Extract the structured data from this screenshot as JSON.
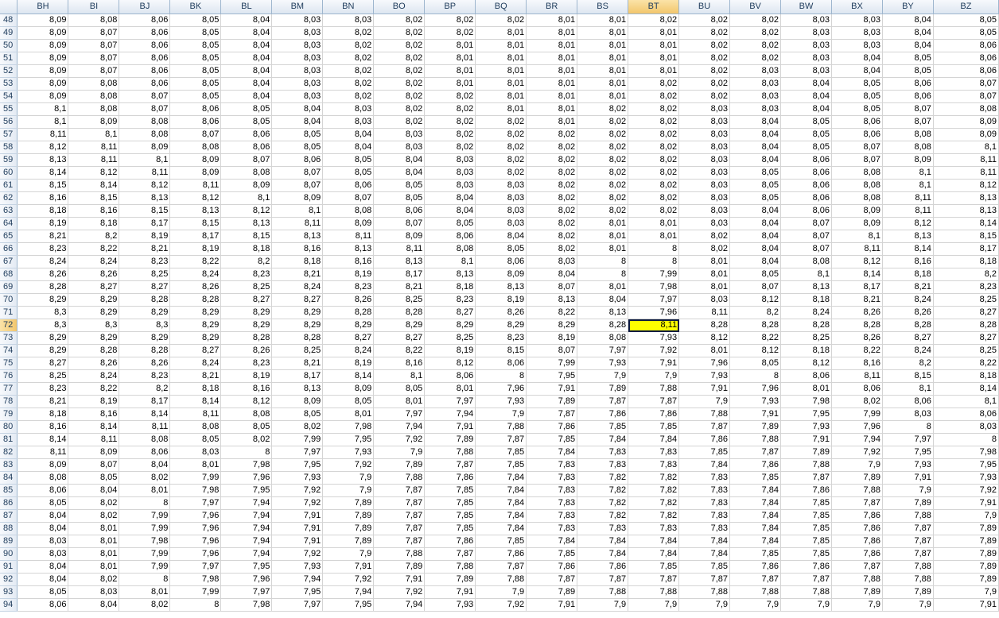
{
  "sheet": {
    "columns": [
      "BH",
      "BI",
      "BJ",
      "BK",
      "BL",
      "BM",
      "BN",
      "BO",
      "BP",
      "BQ",
      "BR",
      "BS",
      "BT",
      "BU",
      "BV",
      "BW",
      "BX",
      "BY",
      "BZ"
    ],
    "active_column": "BT",
    "active_row": "72",
    "selection_color": "#ffff00",
    "rows": [
      {
        "num": "48",
        "cells": [
          "8,09",
          "8,08",
          "8,06",
          "8,05",
          "8,04",
          "8,03",
          "8,03",
          "8,02",
          "8,02",
          "8,02",
          "8,01",
          "8,01",
          "8,02",
          "8,02",
          "8,02",
          "8,03",
          "8,03",
          "8,04",
          "8,05"
        ]
      },
      {
        "num": "49",
        "cells": [
          "8,09",
          "8,07",
          "8,06",
          "8,05",
          "8,04",
          "8,03",
          "8,02",
          "8,02",
          "8,02",
          "8,01",
          "8,01",
          "8,01",
          "8,01",
          "8,02",
          "8,02",
          "8,03",
          "8,03",
          "8,04",
          "8,05"
        ]
      },
      {
        "num": "50",
        "cells": [
          "8,09",
          "8,07",
          "8,06",
          "8,05",
          "8,04",
          "8,03",
          "8,02",
          "8,02",
          "8,01",
          "8,01",
          "8,01",
          "8,01",
          "8,01",
          "8,02",
          "8,02",
          "8,03",
          "8,03",
          "8,04",
          "8,06"
        ]
      },
      {
        "num": "51",
        "cells": [
          "8,09",
          "8,07",
          "8,06",
          "8,05",
          "8,04",
          "8,03",
          "8,02",
          "8,02",
          "8,01",
          "8,01",
          "8,01",
          "8,01",
          "8,01",
          "8,02",
          "8,02",
          "8,03",
          "8,04",
          "8,05",
          "8,06"
        ]
      },
      {
        "num": "52",
        "cells": [
          "8,09",
          "8,07",
          "8,06",
          "8,05",
          "8,04",
          "8,03",
          "8,02",
          "8,02",
          "8,01",
          "8,01",
          "8,01",
          "8,01",
          "8,01",
          "8,02",
          "8,03",
          "8,03",
          "8,04",
          "8,05",
          "8,06"
        ]
      },
      {
        "num": "53",
        "cells": [
          "8,09",
          "8,08",
          "8,06",
          "8,05",
          "8,04",
          "8,03",
          "8,02",
          "8,02",
          "8,01",
          "8,01",
          "8,01",
          "8,01",
          "8,02",
          "8,02",
          "8,03",
          "8,04",
          "8,05",
          "8,06",
          "8,07"
        ]
      },
      {
        "num": "54",
        "cells": [
          "8,09",
          "8,08",
          "8,07",
          "8,05",
          "8,04",
          "8,03",
          "8,02",
          "8,02",
          "8,02",
          "8,01",
          "8,01",
          "8,01",
          "8,02",
          "8,02",
          "8,03",
          "8,04",
          "8,05",
          "8,06",
          "8,07"
        ]
      },
      {
        "num": "55",
        "cells": [
          "8,1",
          "8,08",
          "8,07",
          "8,06",
          "8,05",
          "8,04",
          "8,03",
          "8,02",
          "8,02",
          "8,01",
          "8,01",
          "8,02",
          "8,02",
          "8,03",
          "8,03",
          "8,04",
          "8,05",
          "8,07",
          "8,08"
        ]
      },
      {
        "num": "56",
        "cells": [
          "8,1",
          "8,09",
          "8,08",
          "8,06",
          "8,05",
          "8,04",
          "8,03",
          "8,02",
          "8,02",
          "8,02",
          "8,01",
          "8,02",
          "8,02",
          "8,03",
          "8,04",
          "8,05",
          "8,06",
          "8,07",
          "8,09"
        ]
      },
      {
        "num": "57",
        "cells": [
          "8,11",
          "8,1",
          "8,08",
          "8,07",
          "8,06",
          "8,05",
          "8,04",
          "8,03",
          "8,02",
          "8,02",
          "8,02",
          "8,02",
          "8,02",
          "8,03",
          "8,04",
          "8,05",
          "8,06",
          "8,08",
          "8,09"
        ]
      },
      {
        "num": "58",
        "cells": [
          "8,12",
          "8,11",
          "8,09",
          "8,08",
          "8,06",
          "8,05",
          "8,04",
          "8,03",
          "8,02",
          "8,02",
          "8,02",
          "8,02",
          "8,02",
          "8,03",
          "8,04",
          "8,05",
          "8,07",
          "8,08",
          "8,1"
        ]
      },
      {
        "num": "59",
        "cells": [
          "8,13",
          "8,11",
          "8,1",
          "8,09",
          "8,07",
          "8,06",
          "8,05",
          "8,04",
          "8,03",
          "8,02",
          "8,02",
          "8,02",
          "8,02",
          "8,03",
          "8,04",
          "8,06",
          "8,07",
          "8,09",
          "8,11"
        ]
      },
      {
        "num": "60",
        "cells": [
          "8,14",
          "8,12",
          "8,11",
          "8,09",
          "8,08",
          "8,07",
          "8,05",
          "8,04",
          "8,03",
          "8,02",
          "8,02",
          "8,02",
          "8,02",
          "8,03",
          "8,05",
          "8,06",
          "8,08",
          "8,1",
          "8,11"
        ]
      },
      {
        "num": "61",
        "cells": [
          "8,15",
          "8,14",
          "8,12",
          "8,11",
          "8,09",
          "8,07",
          "8,06",
          "8,05",
          "8,03",
          "8,03",
          "8,02",
          "8,02",
          "8,02",
          "8,03",
          "8,05",
          "8,06",
          "8,08",
          "8,1",
          "8,12"
        ]
      },
      {
        "num": "62",
        "cells": [
          "8,16",
          "8,15",
          "8,13",
          "8,12",
          "8,1",
          "8,09",
          "8,07",
          "8,05",
          "8,04",
          "8,03",
          "8,02",
          "8,02",
          "8,02",
          "8,03",
          "8,05",
          "8,06",
          "8,08",
          "8,11",
          "8,13"
        ]
      },
      {
        "num": "63",
        "cells": [
          "8,18",
          "8,16",
          "8,15",
          "8,13",
          "8,12",
          "8,1",
          "8,08",
          "8,06",
          "8,04",
          "8,03",
          "8,02",
          "8,02",
          "8,02",
          "8,03",
          "8,04",
          "8,06",
          "8,09",
          "8,11",
          "8,13"
        ]
      },
      {
        "num": "64",
        "cells": [
          "8,19",
          "8,18",
          "8,17",
          "8,15",
          "8,13",
          "8,11",
          "8,09",
          "8,07",
          "8,05",
          "8,03",
          "8,02",
          "8,01",
          "8,01",
          "8,03",
          "8,04",
          "8,07",
          "8,09",
          "8,12",
          "8,14"
        ]
      },
      {
        "num": "65",
        "cells": [
          "8,21",
          "8,2",
          "8,19",
          "8,17",
          "8,15",
          "8,13",
          "8,11",
          "8,09",
          "8,06",
          "8,04",
          "8,02",
          "8,01",
          "8,01",
          "8,02",
          "8,04",
          "8,07",
          "8,1",
          "8,13",
          "8,15"
        ]
      },
      {
        "num": "66",
        "cells": [
          "8,23",
          "8,22",
          "8,21",
          "8,19",
          "8,18",
          "8,16",
          "8,13",
          "8,11",
          "8,08",
          "8,05",
          "8,02",
          "8,01",
          "8",
          "8,02",
          "8,04",
          "8,07",
          "8,11",
          "8,14",
          "8,17"
        ]
      },
      {
        "num": "67",
        "cells": [
          "8,24",
          "8,24",
          "8,23",
          "8,22",
          "8,2",
          "8,18",
          "8,16",
          "8,13",
          "8,1",
          "8,06",
          "8,03",
          "8",
          "8",
          "8,01",
          "8,04",
          "8,08",
          "8,12",
          "8,16",
          "8,18"
        ]
      },
      {
        "num": "68",
        "cells": [
          "8,26",
          "8,26",
          "8,25",
          "8,24",
          "8,23",
          "8,21",
          "8,19",
          "8,17",
          "8,13",
          "8,09",
          "8,04",
          "8",
          "7,99",
          "8,01",
          "8,05",
          "8,1",
          "8,14",
          "8,18",
          "8,2"
        ]
      },
      {
        "num": "69",
        "cells": [
          "8,28",
          "8,27",
          "8,27",
          "8,26",
          "8,25",
          "8,24",
          "8,23",
          "8,21",
          "8,18",
          "8,13",
          "8,07",
          "8,01",
          "7,98",
          "8,01",
          "8,07",
          "8,13",
          "8,17",
          "8,21",
          "8,23"
        ]
      },
      {
        "num": "70",
        "cells": [
          "8,29",
          "8,29",
          "8,28",
          "8,28",
          "8,27",
          "8,27",
          "8,26",
          "8,25",
          "8,23",
          "8,19",
          "8,13",
          "8,04",
          "7,97",
          "8,03",
          "8,12",
          "8,18",
          "8,21",
          "8,24",
          "8,25"
        ]
      },
      {
        "num": "71",
        "cells": [
          "8,3",
          "8,29",
          "8,29",
          "8,29",
          "8,29",
          "8,29",
          "8,28",
          "8,28",
          "8,27",
          "8,26",
          "8,22",
          "8,13",
          "7,96",
          "8,11",
          "8,2",
          "8,24",
          "8,26",
          "8,26",
          "8,27"
        ]
      },
      {
        "num": "72",
        "cells": [
          "8,3",
          "8,3",
          "8,3",
          "8,29",
          "8,29",
          "8,29",
          "8,29",
          "8,29",
          "8,29",
          "8,29",
          "8,29",
          "8,28",
          "8,11",
          "8,28",
          "8,28",
          "8,28",
          "8,28",
          "8,28",
          "8,28"
        ]
      },
      {
        "num": "73",
        "cells": [
          "8,29",
          "8,29",
          "8,29",
          "8,29",
          "8,28",
          "8,28",
          "8,27",
          "8,27",
          "8,25",
          "8,23",
          "8,19",
          "8,08",
          "7,93",
          "8,12",
          "8,22",
          "8,25",
          "8,26",
          "8,27",
          "8,27"
        ]
      },
      {
        "num": "74",
        "cells": [
          "8,29",
          "8,28",
          "8,28",
          "8,27",
          "8,26",
          "8,25",
          "8,24",
          "8,22",
          "8,19",
          "8,15",
          "8,07",
          "7,97",
          "7,92",
          "8,01",
          "8,12",
          "8,18",
          "8,22",
          "8,24",
          "8,25"
        ]
      },
      {
        "num": "75",
        "cells": [
          "8,27",
          "8,26",
          "8,26",
          "8,24",
          "8,23",
          "8,21",
          "8,19",
          "8,16",
          "8,12",
          "8,06",
          "7,99",
          "7,93",
          "7,91",
          "7,96",
          "8,05",
          "8,12",
          "8,16",
          "8,2",
          "8,22"
        ]
      },
      {
        "num": "76",
        "cells": [
          "8,25",
          "8,24",
          "8,23",
          "8,21",
          "8,19",
          "8,17",
          "8,14",
          "8,1",
          "8,06",
          "8",
          "7,95",
          "7,9",
          "7,9",
          "7,93",
          "8",
          "8,06",
          "8,11",
          "8,15",
          "8,18"
        ]
      },
      {
        "num": "77",
        "cells": [
          "8,23",
          "8,22",
          "8,2",
          "8,18",
          "8,16",
          "8,13",
          "8,09",
          "8,05",
          "8,01",
          "7,96",
          "7,91",
          "7,89",
          "7,88",
          "7,91",
          "7,96",
          "8,01",
          "8,06",
          "8,1",
          "8,14"
        ]
      },
      {
        "num": "78",
        "cells": [
          "8,21",
          "8,19",
          "8,17",
          "8,14",
          "8,12",
          "8,09",
          "8,05",
          "8,01",
          "7,97",
          "7,93",
          "7,89",
          "7,87",
          "7,87",
          "7,9",
          "7,93",
          "7,98",
          "8,02",
          "8,06",
          "8,1"
        ]
      },
      {
        "num": "79",
        "cells": [
          "8,18",
          "8,16",
          "8,14",
          "8,11",
          "8,08",
          "8,05",
          "8,01",
          "7,97",
          "7,94",
          "7,9",
          "7,87",
          "7,86",
          "7,86",
          "7,88",
          "7,91",
          "7,95",
          "7,99",
          "8,03",
          "8,06"
        ]
      },
      {
        "num": "80",
        "cells": [
          "8,16",
          "8,14",
          "8,11",
          "8,08",
          "8,05",
          "8,02",
          "7,98",
          "7,94",
          "7,91",
          "7,88",
          "7,86",
          "7,85",
          "7,85",
          "7,87",
          "7,89",
          "7,93",
          "7,96",
          "8",
          "8,03"
        ]
      },
      {
        "num": "81",
        "cells": [
          "8,14",
          "8,11",
          "8,08",
          "8,05",
          "8,02",
          "7,99",
          "7,95",
          "7,92",
          "7,89",
          "7,87",
          "7,85",
          "7,84",
          "7,84",
          "7,86",
          "7,88",
          "7,91",
          "7,94",
          "7,97",
          "8"
        ]
      },
      {
        "num": "82",
        "cells": [
          "8,11",
          "8,09",
          "8,06",
          "8,03",
          "8",
          "7,97",
          "7,93",
          "7,9",
          "7,88",
          "7,85",
          "7,84",
          "7,83",
          "7,83",
          "7,85",
          "7,87",
          "7,89",
          "7,92",
          "7,95",
          "7,98"
        ]
      },
      {
        "num": "83",
        "cells": [
          "8,09",
          "8,07",
          "8,04",
          "8,01",
          "7,98",
          "7,95",
          "7,92",
          "7,89",
          "7,87",
          "7,85",
          "7,83",
          "7,83",
          "7,83",
          "7,84",
          "7,86",
          "7,88",
          "7,9",
          "7,93",
          "7,95"
        ]
      },
      {
        "num": "84",
        "cells": [
          "8,08",
          "8,05",
          "8,02",
          "7,99",
          "7,96",
          "7,93",
          "7,9",
          "7,88",
          "7,86",
          "7,84",
          "7,83",
          "7,82",
          "7,82",
          "7,83",
          "7,85",
          "7,87",
          "7,89",
          "7,91",
          "7,93"
        ]
      },
      {
        "num": "85",
        "cells": [
          "8,06",
          "8,04",
          "8,01",
          "7,98",
          "7,95",
          "7,92",
          "7,9",
          "7,87",
          "7,85",
          "7,84",
          "7,83",
          "7,82",
          "7,82",
          "7,83",
          "7,84",
          "7,86",
          "7,88",
          "7,9",
          "7,92"
        ]
      },
      {
        "num": "86",
        "cells": [
          "8,05",
          "8,02",
          "8",
          "7,97",
          "7,94",
          "7,92",
          "7,89",
          "7,87",
          "7,85",
          "7,84",
          "7,83",
          "7,82",
          "7,82",
          "7,83",
          "7,84",
          "7,85",
          "7,87",
          "7,89",
          "7,91"
        ]
      },
      {
        "num": "87",
        "cells": [
          "8,04",
          "8,02",
          "7,99",
          "7,96",
          "7,94",
          "7,91",
          "7,89",
          "7,87",
          "7,85",
          "7,84",
          "7,83",
          "7,82",
          "7,82",
          "7,83",
          "7,84",
          "7,85",
          "7,86",
          "7,88",
          "7,9"
        ]
      },
      {
        "num": "88",
        "cells": [
          "8,04",
          "8,01",
          "7,99",
          "7,96",
          "7,94",
          "7,91",
          "7,89",
          "7,87",
          "7,85",
          "7,84",
          "7,83",
          "7,83",
          "7,83",
          "7,83",
          "7,84",
          "7,85",
          "7,86",
          "7,87",
          "7,89"
        ]
      },
      {
        "num": "89",
        "cells": [
          "8,03",
          "8,01",
          "7,98",
          "7,96",
          "7,94",
          "7,91",
          "7,89",
          "7,87",
          "7,86",
          "7,85",
          "7,84",
          "7,84",
          "7,84",
          "7,84",
          "7,84",
          "7,85",
          "7,86",
          "7,87",
          "7,89"
        ]
      },
      {
        "num": "90",
        "cells": [
          "8,03",
          "8,01",
          "7,99",
          "7,96",
          "7,94",
          "7,92",
          "7,9",
          "7,88",
          "7,87",
          "7,86",
          "7,85",
          "7,84",
          "7,84",
          "7,84",
          "7,85",
          "7,85",
          "7,86",
          "7,87",
          "7,89"
        ]
      },
      {
        "num": "91",
        "cells": [
          "8,04",
          "8,01",
          "7,99",
          "7,97",
          "7,95",
          "7,93",
          "7,91",
          "7,89",
          "7,88",
          "7,87",
          "7,86",
          "7,86",
          "7,85",
          "7,85",
          "7,86",
          "7,86",
          "7,87",
          "7,88",
          "7,89"
        ]
      },
      {
        "num": "92",
        "cells": [
          "8,04",
          "8,02",
          "8",
          "7,98",
          "7,96",
          "7,94",
          "7,92",
          "7,91",
          "7,89",
          "7,88",
          "7,87",
          "7,87",
          "7,87",
          "7,87",
          "7,87",
          "7,87",
          "7,88",
          "7,88",
          "7,89"
        ]
      },
      {
        "num": "93",
        "cells": [
          "8,05",
          "8,03",
          "8,01",
          "7,99",
          "7,97",
          "7,95",
          "7,94",
          "7,92",
          "7,91",
          "7,9",
          "7,89",
          "7,88",
          "7,88",
          "7,88",
          "7,88",
          "7,88",
          "7,89",
          "7,89",
          "7,9"
        ]
      },
      {
        "num": "94",
        "cells": [
          "8,06",
          "8,04",
          "8,02",
          "8",
          "7,98",
          "7,97",
          "7,95",
          "7,94",
          "7,93",
          "7,92",
          "7,91",
          "7,9",
          "7,9",
          "7,9",
          "7,9",
          "7,9",
          "7,9",
          "7,9",
          "7,91"
        ]
      }
    ]
  }
}
